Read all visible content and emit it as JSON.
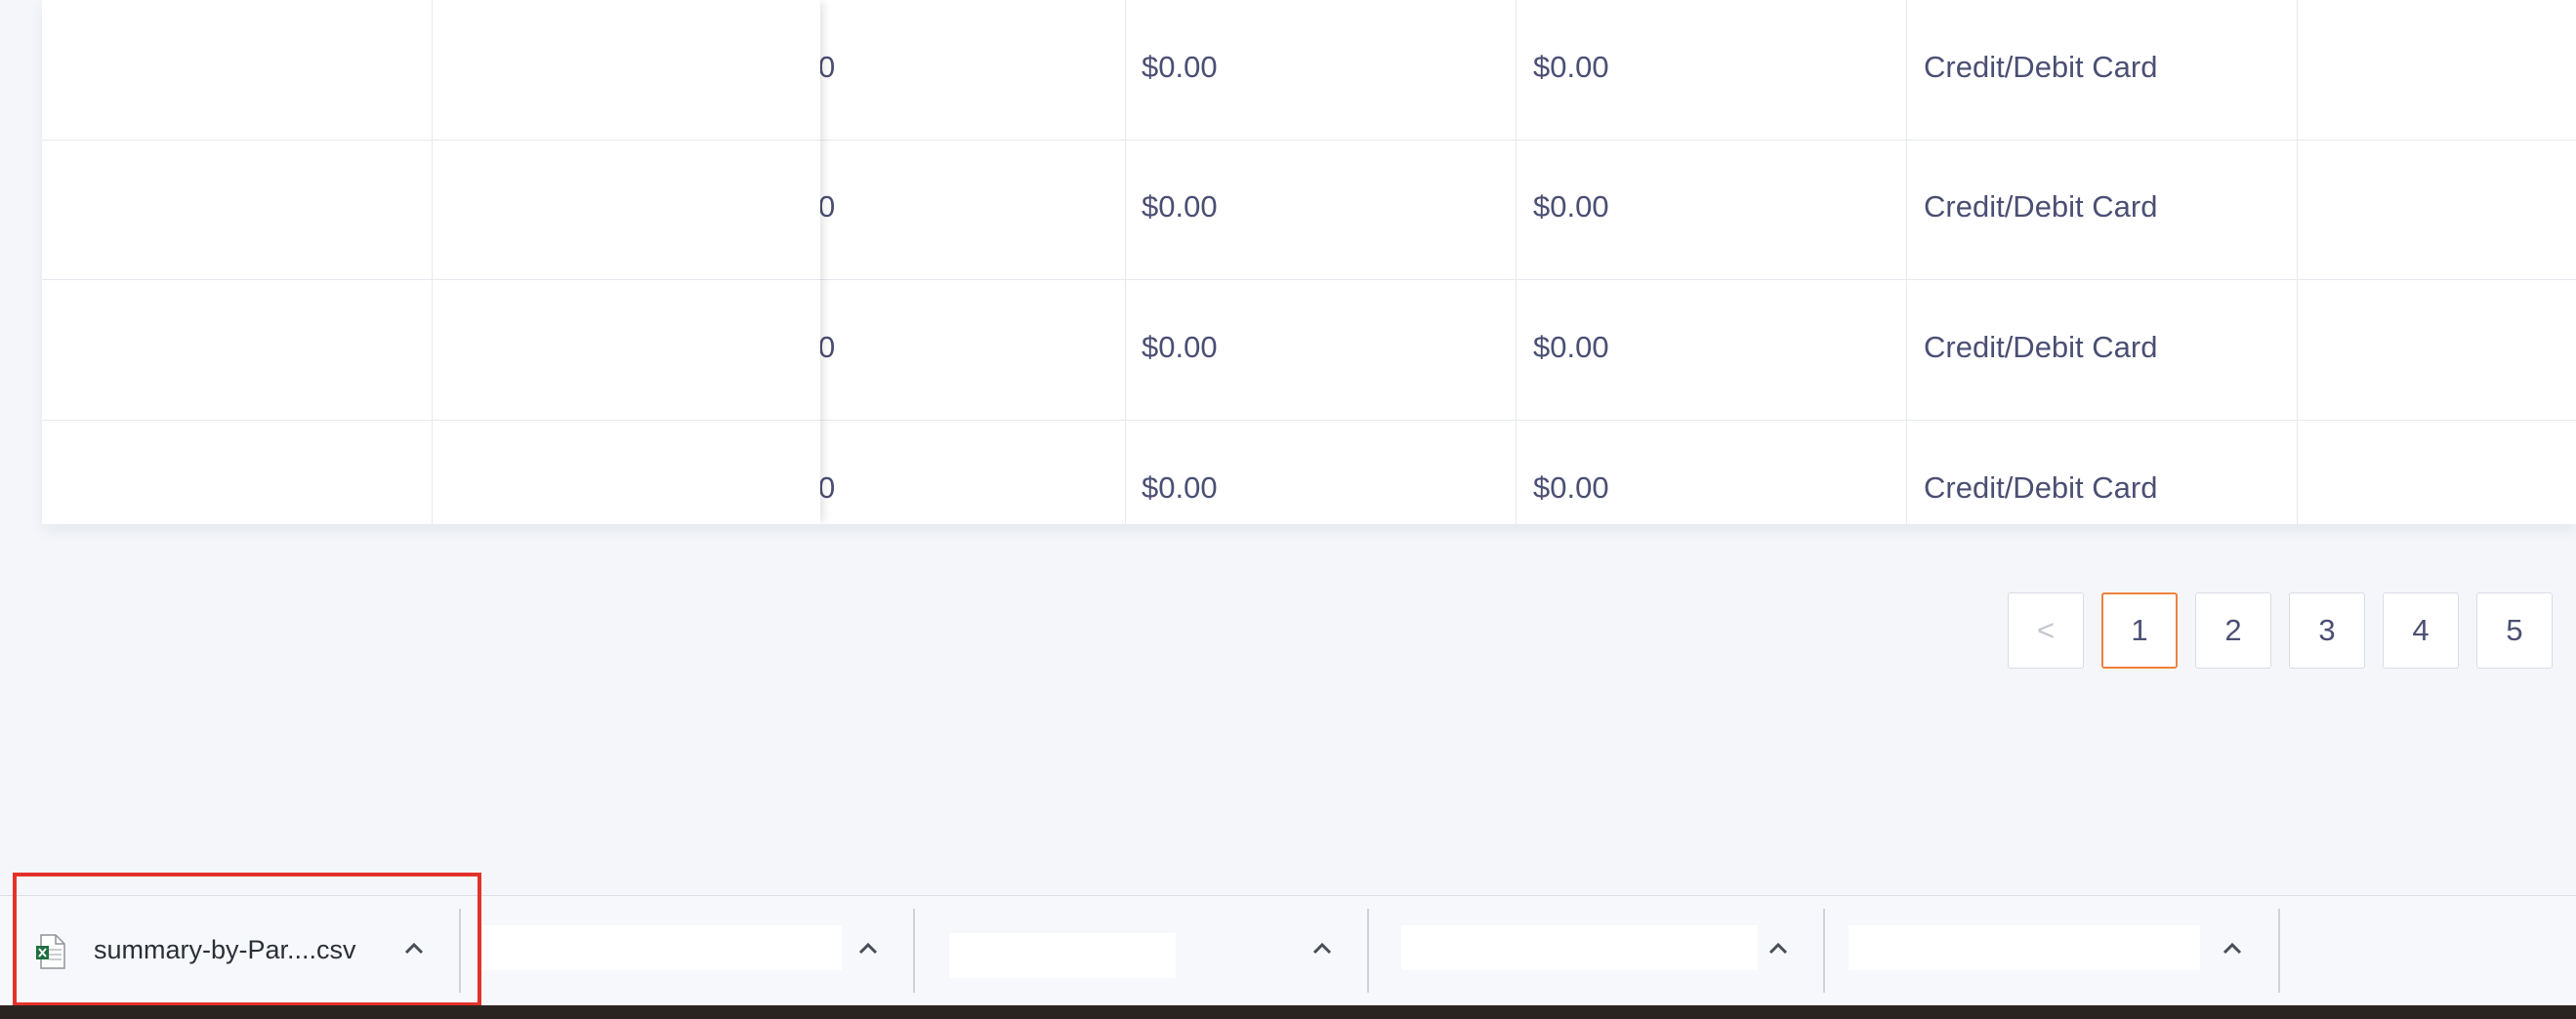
{
  "table": {
    "rows": [
      {
        "col_partial": "0",
        "amount_a": "$0.00",
        "amount_b": "$0.00",
        "payment_method": "Credit/Debit Card"
      },
      {
        "col_partial": "0",
        "amount_a": "$0.00",
        "amount_b": "$0.00",
        "payment_method": "Credit/Debit Card"
      },
      {
        "col_partial": "0",
        "amount_a": "$0.00",
        "amount_b": "$0.00",
        "payment_method": "Credit/Debit Card"
      },
      {
        "col_partial": "0",
        "amount_a": "$0.00",
        "amount_b": "$0.00",
        "payment_method": "Credit/Debit Card"
      }
    ]
  },
  "pagination": {
    "prev_label": "<",
    "pages": [
      "1",
      "2",
      "3",
      "4",
      "5"
    ],
    "current_page": "1",
    "active_color": "#f0803c"
  },
  "download_shelf": {
    "file_name": "summary-by-Par....csv",
    "file_icon": "excel-csv-file-icon",
    "highlight_color": "#e4322b"
  }
}
